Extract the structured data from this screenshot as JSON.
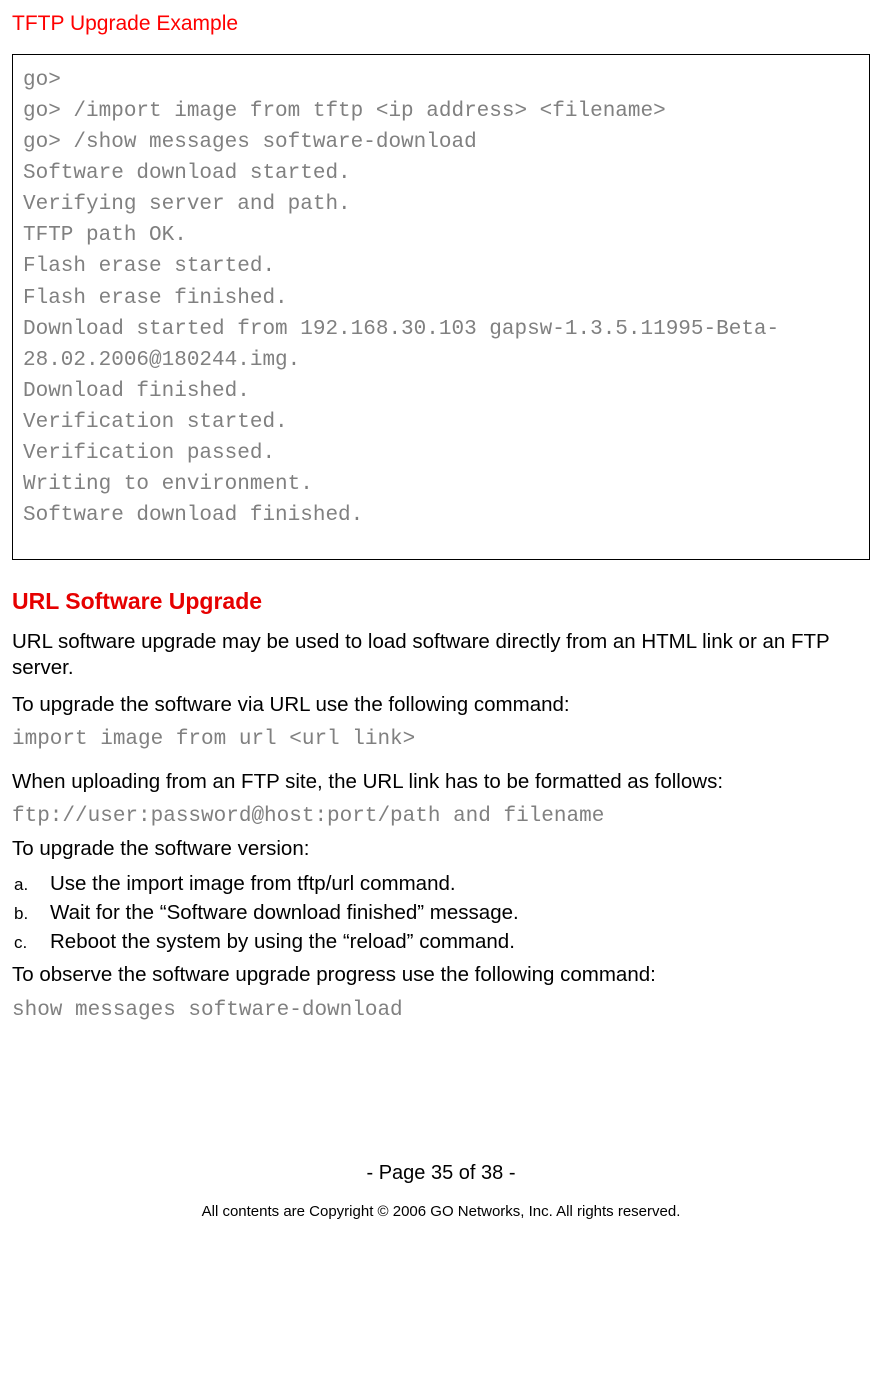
{
  "heading1": "TFTP Upgrade Example",
  "code": {
    "l1": "go>",
    "l2": "go> /import image from tftp <ip address> <filename>",
    "l3": "go> /show messages software-download",
    "l4": "Software download started.",
    "l5": "Verifying server and path.",
    "l6": "TFTP path OK.",
    "l7": "Flash erase started.",
    "l8": "Flash erase finished.",
    "l9": "Download started from 192.168.30.103 gapsw-1.3.5.11995-Beta-28.02.2006@180244.img.",
    "l10": "Download finished.",
    "l11": "Verification started.",
    "l12": "Verification passed.",
    "l13": "Writing to environment.",
    "l14": "Software download finished."
  },
  "heading2": "URL Software Upgrade",
  "p1": "URL software upgrade may be used to load software directly from an HTML link or an FTP server.",
  "p2": "To upgrade the software via URL use the following command:",
  "cmd1": "import image from url <url link>",
  "p3": "When uploading from an FTP site, the URL link has to be formatted as follows:",
  "cmd2": "ftp://user:password@host:port/path and filename",
  "p4": "To upgrade the software version:",
  "steps": {
    "a_label": "a.",
    "a_text": "Use the import image from tftp/url command.",
    "b_label": "b.",
    "b_text": "Wait for the “Software download finished” message.",
    "c_label": "c.",
    "c_text": "Reboot the system by using the “reload” command."
  },
  "p5": "To observe the software upgrade progress use the following command:",
  "cmd3": "show messages software-download",
  "page_num": "- Page 35 of 38 -",
  "copyright": "All contents are Copyright © 2006 GO Networks, Inc. All rights reserved."
}
